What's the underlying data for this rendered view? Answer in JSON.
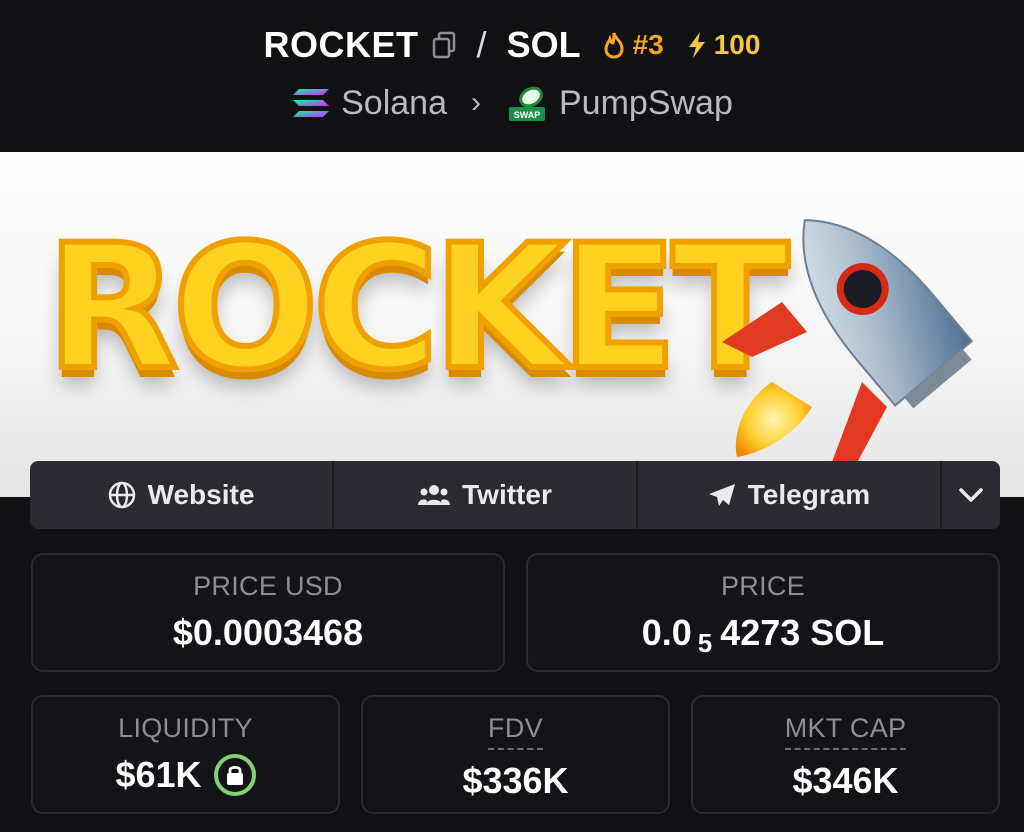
{
  "pair": {
    "base": "ROCKET",
    "separator": "/",
    "quote": "SOL",
    "rank": "#3",
    "boosts": "100"
  },
  "route": {
    "chain": "Solana",
    "dex": "PumpSwap",
    "dex_badge": "SWAP"
  },
  "banner": {
    "text": "ROCKET"
  },
  "links": {
    "website": "Website",
    "twitter": "Twitter",
    "telegram": "Telegram"
  },
  "stats": {
    "price_usd_label": "PRICE USD",
    "price_usd": "$0.0003468",
    "price_label": "PRICE",
    "price_prefix": "0.0",
    "price_subscript": "5",
    "price_suffix": "4273 SOL",
    "liquidity_label": "LIQUIDITY",
    "liquidity": "$61K",
    "fdv_label": "FDV",
    "fdv": "$336K",
    "mktcap_label": "MKT CAP",
    "mktcap": "$346K"
  },
  "icons": {
    "copy": "copy-icon",
    "rank": "flame-icon",
    "boost": "lightning-icon",
    "chain": "solana-icon",
    "dex": "pumpswap-icon",
    "website": "globe-icon",
    "twitter": "users-icon",
    "telegram": "paper-plane-icon",
    "more": "chevron-down-icon",
    "liquidity_lock": "lock-icon"
  },
  "colors": {
    "background": "#111114",
    "rank": "#f5a623",
    "boost": "#f6c544",
    "lock_ring": "#7fd36b",
    "label": "#8d8d95",
    "card_border": "#2b2b31"
  }
}
